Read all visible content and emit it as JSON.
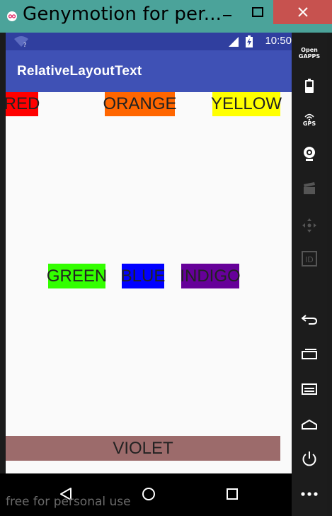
{
  "window": {
    "title": "Genymotion for per..."
  },
  "statusbar": {
    "time": "10:50"
  },
  "app": {
    "title": "RelativeLayoutText"
  },
  "colors": {
    "red": "#ff0000",
    "orange": "#ff6600",
    "yellow": "#ffff00",
    "green": "#33ff00",
    "blue": "#0000ff",
    "indigo": "#660099",
    "violet": "#9c6b6b"
  },
  "labels": {
    "red": "RED",
    "orange": "ORANGE",
    "yellow": "YELLOW",
    "green": "GREEN",
    "blue": "BLUE",
    "indigo": "INDIGO",
    "violet": "VIOLET"
  },
  "panel": {
    "open_gapps": "Open\nGAPPS",
    "gps": "GPS",
    "id_label": "ID"
  },
  "watermark": "free for personal use"
}
